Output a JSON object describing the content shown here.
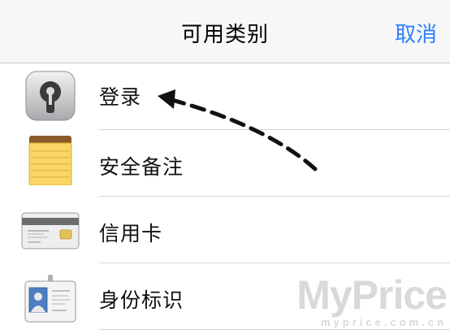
{
  "header": {
    "title": "可用类别",
    "cancel_label": "取消"
  },
  "categories": [
    {
      "label": "登录",
      "icon": "login-lock-icon"
    },
    {
      "label": "安全备注",
      "icon": "secure-note-icon"
    },
    {
      "label": "信用卡",
      "icon": "credit-card-icon"
    },
    {
      "label": "身份标识",
      "icon": "identity-badge-icon"
    }
  ],
  "watermark": {
    "brand": "MyPrice",
    "url": "myprice.com.cn"
  },
  "colors": {
    "accent": "#2d7ff9",
    "nav_background": "#f7f7f8"
  }
}
